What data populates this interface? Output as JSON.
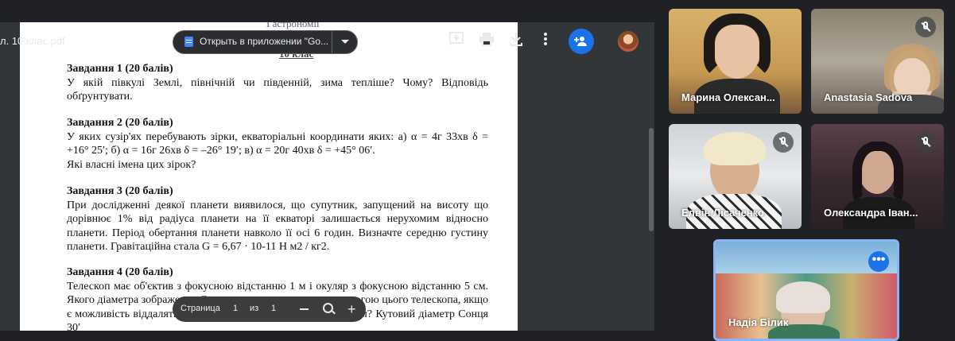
{
  "toolbar": {
    "filename": "л. 10 клас.pdf",
    "open_in_app": "Открыть в приложении \"Go..."
  },
  "document": {
    "header_top": "І астрономії",
    "header_class": "10 клас",
    "tasks": [
      {
        "heading": "Завдання 1 (20 балів)",
        "lines": [
          "У якій півкулі Землі, північній чи південній, зима тепліше?  Чому?  Відповідь обґрунтувати."
        ]
      },
      {
        "heading": "Завдання 2 (20 балів)",
        "lines": [
          "У яких сузір'ях перебувають зірки, екваторіальні координати яких: а) α = 4г 33хв  δ = +16° 25′;   б) α = 16г 26хв  δ = –26° 19′;   в) α = 20г 40хв δ = +45° 06′.",
          "Які власні імена цих зірок?"
        ]
      },
      {
        "heading": "Завдання 3 (20 балів)",
        "lines": [
          "При дослідженні деякої планети виявилося, що супутник, запущений на висоту що дорівнює 1% від радіуса планети на її екваторі залишається нерухомим відносно планети. Період обертання планети навколо її осі 6 годин. Визначте середню густину планети. Гравітаційна стала  G = 6,67 · 10-11 Н м2 / кг2."
        ]
      },
      {
        "heading": "Завдання 4 (20 балів)",
        "lines": [
          "Телескоп має об'єктив з фокусною відстанню 1 м і окуляр з фокусною відстанню 5 см. Якого діаметра зображення Сонця можна отримати за допомогою цього телескопа, якщо є можливість віддаляти екран від окуляра на відстань до 1,5 м? Кутовий діаметр Сонця 30′"
        ]
      }
    ]
  },
  "pagenav": {
    "page_label": "Страница",
    "page_current": "1",
    "of_label": "из",
    "page_total": "1"
  },
  "participants": [
    {
      "name": "Марина Олексан...",
      "muted": false
    },
    {
      "name": "Anastasia Sadova",
      "muted": true
    },
    {
      "name": "Елвін Лісаченко",
      "muted": true
    },
    {
      "name": "Олександра Іван...",
      "muted": true
    },
    {
      "name": "Надія Білик",
      "muted": false,
      "active": true
    }
  ],
  "colors": {
    "accent": "#1a73e8",
    "background": "#202124"
  }
}
